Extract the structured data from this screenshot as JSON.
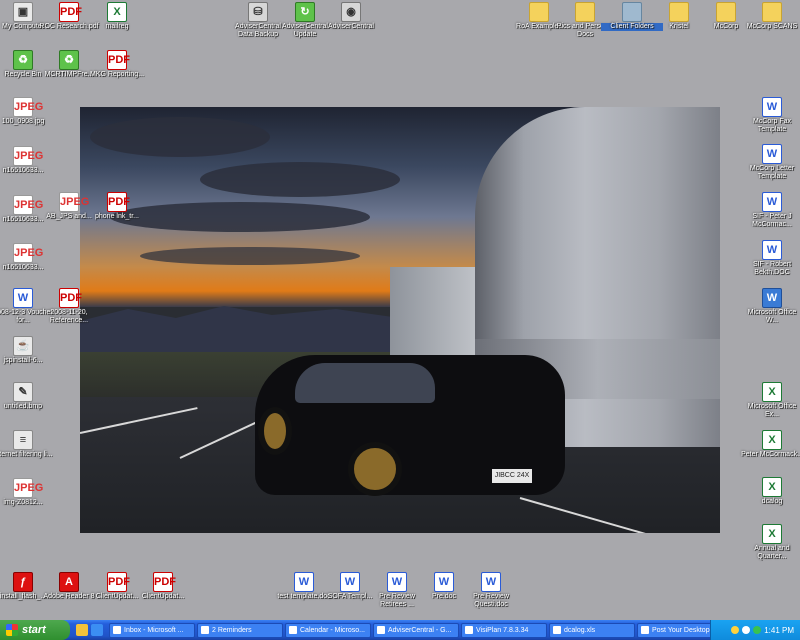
{
  "desktop": {
    "left_icons": [
      {
        "label": "My Computer",
        "icon": "computer-icon"
      },
      {
        "label": "Recycle Bin",
        "icon": "recycle-bin-icon"
      },
      {
        "label": "100_0908.jpg",
        "icon": "jpeg-icon"
      },
      {
        "label": "n16510633...",
        "icon": "jpeg-icon"
      },
      {
        "label": "n16510633...",
        "icon": "jpeg-icon"
      },
      {
        "label": "n16510633...",
        "icon": "jpeg-icon"
      },
      {
        "label": "2008-12-3 Voucher for...",
        "icon": "word-icon"
      },
      {
        "label": "jspinstall-6...",
        "icon": "java-icon"
      },
      {
        "label": "untitled.bmp",
        "icon": "bitmap-icon"
      },
      {
        "label": "Internet filtering li...",
        "icon": "document-icon"
      },
      {
        "label": "img-Z0812...",
        "icon": "jpeg-icon"
      },
      {
        "label": "install_flash_...",
        "icon": "flash-icon"
      }
    ],
    "second_column": [
      {
        "label": "ROC Research.pdf",
        "icon": "pdf-icon"
      },
      {
        "label": "MCRTIMPFre...",
        "icon": "recycle-app-icon"
      },
      {
        "label": "AB_JPS and...",
        "icon": "jpeg-icon"
      },
      {
        "label": "2008-11-20, Reference...",
        "icon": "pdf-icon"
      },
      {
        "label": "Adobe Reader 8",
        "icon": "acrobat-icon"
      }
    ],
    "third_column": [
      {
        "label": "mailreg",
        "icon": "excel-icon"
      },
      {
        "label": "MKG Reporting...",
        "icon": "pdf-icon"
      },
      {
        "label": "phone lnk_tr...",
        "icon": "pdf-icon"
      },
      {
        "label": "ClientUpdat...",
        "icon": "pdf-icon"
      }
    ],
    "top_center_icons": [
      {
        "label": "AdviserCentral Data Backup",
        "icon": "backup-icon"
      },
      {
        "label": "AdviserCentral Update",
        "icon": "update-icon"
      },
      {
        "label": "AdviserCentral",
        "icon": "camera-icon"
      }
    ],
    "top_right_icons": [
      {
        "label": "RoA Examples",
        "icon": "folder-icon"
      },
      {
        "label": "Pics and Personal Docs",
        "icon": "folder-icon"
      },
      {
        "label": "Client Folders",
        "icon": "folder-icon",
        "selected": true
      },
      {
        "label": "Kristel",
        "icon": "folder-icon"
      },
      {
        "label": "McCorp",
        "icon": "folder-icon"
      },
      {
        "label": "McCorp SCANS",
        "icon": "folder-icon"
      }
    ],
    "right_icons": [
      {
        "label": "McCorp Fax Template",
        "icon": "word-icon"
      },
      {
        "label": "McCorp Letter Template",
        "icon": "word-icon"
      },
      {
        "label": "SIF - Peter J McCormac...",
        "icon": "word-icon"
      },
      {
        "label": "SIF - Robert Bekth.DOC",
        "icon": "word-icon"
      },
      {
        "label": "Microsoft Office W...",
        "icon": "word-icon"
      },
      {
        "label": "Microsoft Office Ex...",
        "icon": "excel-icon"
      },
      {
        "label": "Peter McCormack...",
        "icon": "excel-icon"
      },
      {
        "label": "dcalog",
        "icon": "excel-icon"
      },
      {
        "label": "Annual and Quarter...",
        "icon": "excel-icon"
      }
    ],
    "bottom_icons": [
      {
        "label": "ClientUpdat...",
        "icon": "pdf-icon"
      },
      {
        "label": "test template.doc",
        "icon": "word-icon"
      },
      {
        "label": "SOFA Templ...",
        "icon": "word-icon"
      },
      {
        "label": "Pre Review Retirees ...",
        "icon": "word-icon"
      },
      {
        "label": "Pre.doc",
        "icon": "word-icon"
      },
      {
        "label": "Pre Review Questi.doc",
        "icon": "word-icon"
      }
    ],
    "wallpaper_plate": "JIBCC 24X"
  },
  "taskbar": {
    "start_label": "start",
    "tasks": [
      {
        "label": "Inbox - Microsoft ..."
      },
      {
        "label": "2 Reminders"
      },
      {
        "label": "Calendar - Microso..."
      },
      {
        "label": "AdviserCentral - G..."
      },
      {
        "label": "VisiPlan 7.8.3.34"
      },
      {
        "label": "dcalog.xls"
      },
      {
        "label": "Post Your Desktop..."
      }
    ],
    "clock": "1:41 PM"
  }
}
